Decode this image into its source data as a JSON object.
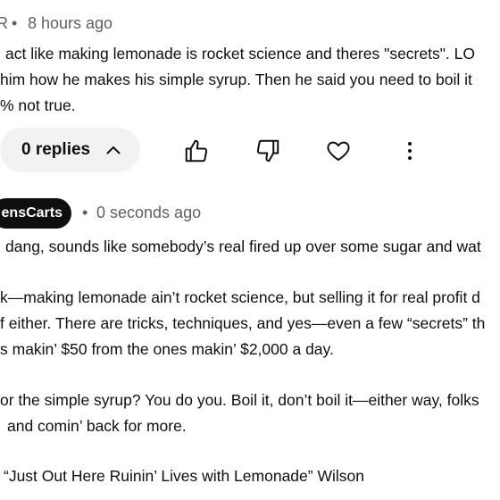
{
  "comment1": {
    "author_fragment": "R",
    "separator": "•",
    "timestamp": "8 hours ago",
    "lines": [
      "act like making lemonade is rocket science and theres \"secrets\".  LO",
      "him how he makes his simple syrup. Then he said you need to boil it",
      "% not true."
    ]
  },
  "actions": {
    "replies_label": "0 replies",
    "like_icon": "thumbs-up-icon",
    "dislike_icon": "thumbs-down-icon",
    "heart_icon": "heart-icon",
    "more_icon": "more-vert-icon"
  },
  "comment2": {
    "author": "ensCarts",
    "separator": "•",
    "timestamp": "0 seconds ago",
    "lines": [
      "dang, sounds like somebody’s real fired up over some sugar and wat",
      "k—making lemonade ain’t rocket science, but selling it for real profit d",
      "f either. There are tricks, techniques, and yes—even a few “secrets” th",
      "s makin’ $50 from the ones makin’ $2,000 a day.",
      "or the simple syrup? You do you. Boil it, don’t boil it—either way, folks",
      "and comin’ back for more.",
      "“Just Out Here Ruinin’ Lives with Lemonade” Wilson"
    ]
  }
}
